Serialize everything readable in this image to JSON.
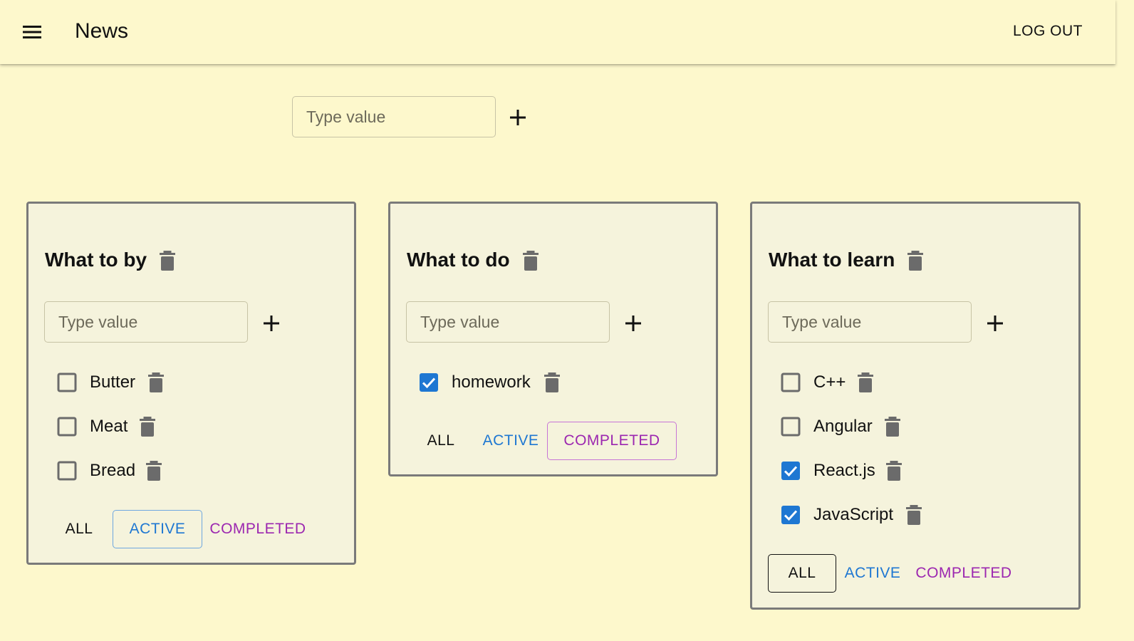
{
  "appbar": {
    "title": "News",
    "logout_label": "LOG OUT",
    "menu_icon": "hamburger-menu-icon"
  },
  "add_list": {
    "placeholder": "Type value",
    "add_icon": "plus-icon"
  },
  "lists": [
    {
      "title": "What to by",
      "placeholder": "Type value",
      "tasks": [
        {
          "label": "Butter",
          "checked": false
        },
        {
          "label": "Meat",
          "checked": false
        },
        {
          "label": "Bread",
          "checked": false
        }
      ],
      "filters": {
        "all": "ALL",
        "active": "ACTIVE",
        "completed": "COMPLETED",
        "selected": "active"
      }
    },
    {
      "title": "What to do",
      "placeholder": "Type value",
      "tasks": [
        {
          "label": "homework",
          "checked": true
        }
      ],
      "filters": {
        "all": "ALL",
        "active": "ACTIVE",
        "completed": "COMPLETED",
        "selected": "completed"
      }
    },
    {
      "title": "What to learn",
      "placeholder": "Type value",
      "tasks": [
        {
          "label": "C++",
          "checked": false
        },
        {
          "label": "Angular",
          "checked": false
        },
        {
          "label": "React.js",
          "checked": true
        },
        {
          "label": "JavaScript",
          "checked": true
        }
      ],
      "filters": {
        "all": "ALL",
        "active": "ACTIVE",
        "completed": "COMPLETED",
        "selected": "all"
      }
    }
  ],
  "colors": {
    "background": "#fdf8cc",
    "card": "#f5f3dc",
    "checkbox_checked": "#1e77d2",
    "active": "#1e77d2",
    "completed": "#9c27b0",
    "trash_icon": "#6b6b6b"
  }
}
